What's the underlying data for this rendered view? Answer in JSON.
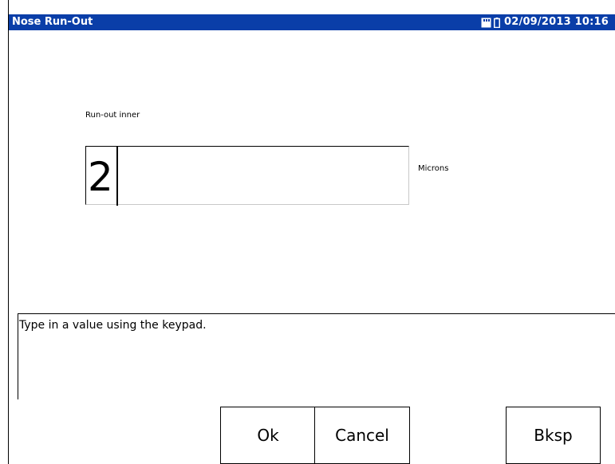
{
  "window": {
    "title": "Nose Run-Out",
    "datetime": "02/09/2013 10:16",
    "sd_icon": "sd-card-icon",
    "battery_icon": "battery-icon"
  },
  "form": {
    "field_label": "Run-out inner",
    "value": "2",
    "unit": "Microns"
  },
  "help": {
    "text": "Type in a value using the keypad."
  },
  "buttons": {
    "ok": "Ok",
    "cancel": "Cancel",
    "backspace": "Bksp"
  },
  "colors": {
    "titlebar": "#0a3ea8",
    "title_text": "#ffffff"
  }
}
